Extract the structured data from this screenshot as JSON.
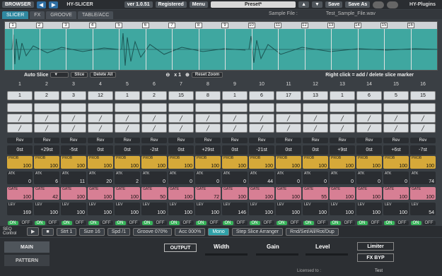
{
  "topbar": {
    "browser": "BROWSER",
    "app": "HY-SLICER",
    "version": "ver 1.0.51",
    "registered": "Registered",
    "menu": "Menu",
    "preset": "Preset*",
    "save": "Save",
    "saveas": "Save As",
    "brand": "HY-Plugins"
  },
  "tabs": [
    "SLICER",
    "FX",
    "GROOVE",
    "TABLE/ACC"
  ],
  "sample": {
    "label": "Sample File :",
    "value": "Test_Sample_File.wav"
  },
  "controls": {
    "autoslice": "Auto Slice",
    "slice": "Slice",
    "deleteall": "Delete All",
    "zoom": "x 1",
    "resetzoom": "Reset Zoom",
    "hint": "Right click = add / delete slice marker"
  },
  "markers": [
    "1",
    "2",
    "3",
    "4",
    "5",
    "6",
    "7",
    "8",
    "9",
    "10",
    "11",
    "12",
    "13",
    "14",
    "15",
    "16"
  ],
  "steps": [
    {
      "num": "1",
      "len": "1",
      "rev": "Rev",
      "pitch": "0st",
      "prob": "100",
      "atk": "0",
      "gate": "100",
      "lev": "169"
    },
    {
      "num": "2",
      "len": "2",
      "rev": "Rev",
      "pitch": "+29st",
      "prob": "100",
      "atk": "6",
      "gate": "42",
      "lev": "100"
    },
    {
      "num": "3",
      "len": "3",
      "rev": "Rev",
      "pitch": "-5st",
      "prob": "100",
      "atk": "11",
      "gate": "100",
      "lev": "100"
    },
    {
      "num": "4",
      "len": "12",
      "rev": "Rev",
      "pitch": "0st",
      "prob": "100",
      "atk": "20",
      "gate": "100",
      "lev": "100"
    },
    {
      "num": "5",
      "len": "1",
      "rev": "Rev",
      "pitch": "0st",
      "prob": "100",
      "atk": "2",
      "gate": "100",
      "lev": "100"
    },
    {
      "num": "6",
      "len": "2",
      "rev": "Rev",
      "pitch": "-2st",
      "prob": "100",
      "atk": "0",
      "gate": "50",
      "lev": "100"
    },
    {
      "num": "7",
      "len": "15",
      "rev": "Rev",
      "pitch": "0st",
      "prob": "100",
      "atk": "0",
      "gate": "100",
      "lev": "100"
    },
    {
      "num": "8",
      "len": "8",
      "rev": "Rev",
      "pitch": "+29st",
      "prob": "100",
      "atk": "0",
      "gate": "72",
      "lev": "100"
    },
    {
      "num": "9",
      "len": "1",
      "rev": "Rev",
      "pitch": "0st",
      "prob": "100",
      "atk": "0",
      "gate": "100",
      "lev": "146"
    },
    {
      "num": "10",
      "len": "6",
      "rev": "Rev",
      "pitch": "-21st",
      "prob": "100",
      "atk": "44",
      "gate": "100",
      "lev": "100"
    },
    {
      "num": "11",
      "len": "17",
      "rev": "Rev",
      "pitch": "0st",
      "prob": "100",
      "atk": "0",
      "gate": "100",
      "lev": "100"
    },
    {
      "num": "12",
      "len": "13",
      "rev": "Rev",
      "pitch": "0st",
      "prob": "100",
      "atk": "0",
      "gate": "55",
      "lev": "100"
    },
    {
      "num": "13",
      "len": "1",
      "rev": "Rev",
      "pitch": "+9st",
      "prob": "100",
      "atk": "0",
      "gate": "100",
      "lev": "100"
    },
    {
      "num": "14",
      "len": "6",
      "rev": "Rev",
      "pitch": "0st",
      "prob": "100",
      "atk": "0",
      "gate": "100",
      "lev": "100"
    },
    {
      "num": "15",
      "len": "5",
      "rev": "Rev",
      "pitch": "+6st",
      "prob": "100",
      "atk": "0",
      "gate": "100",
      "lev": "100"
    },
    {
      "num": "16",
      "len": "15",
      "rev": "Rev",
      "pitch": "-7st",
      "prob": "100",
      "atk": "74",
      "gate": "100",
      "lev": "54"
    }
  ],
  "labels": {
    "prob": "PROB",
    "atk": "ATK",
    "gate": "GATE",
    "lev": "LEV",
    "on": "ON",
    "off": "OFF"
  },
  "bottom": {
    "seq": "SEQ Control",
    "strt": "Strt 1",
    "size": "Size 16",
    "spd": "Spd /1",
    "groove": "Groove 070%",
    "acc": "Acc 000%",
    "mono": "Mono",
    "arranger": "Step Slice Arranger",
    "rnd": "Rnd/Set/All/Rot/Dup"
  },
  "footer": {
    "main": "MAIN",
    "pattern": "PATTERN",
    "output": "OUTPUT",
    "width": "Width",
    "gain": "Gain",
    "level": "Level",
    "limiter": "Limiter",
    "fxbyp": "FX BYP",
    "licensed": "Licensed to :",
    "user": "Test"
  }
}
